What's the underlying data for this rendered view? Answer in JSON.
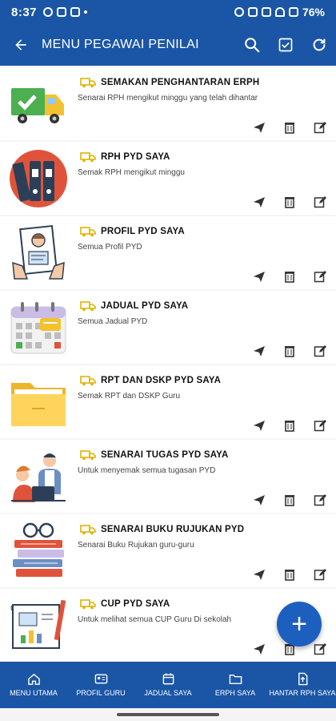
{
  "status_bar": {
    "time": "8:37",
    "battery": "76%"
  },
  "app_bar": {
    "title": "MENU PEGAWAI PENILAI"
  },
  "menu_items": [
    {
      "title": "SEMAKAN PENGHANTARAN ERPH",
      "subtitle": "Senarai RPH mengikut minggu yang telah dihantar"
    },
    {
      "title": "RPH PYD SAYA",
      "subtitle": "Semak RPH mengikut minggu"
    },
    {
      "title": "PROFIL PYD SAYA",
      "subtitle": "Semua Profil PYD"
    },
    {
      "title": "JADUAL PYD SAYA",
      "subtitle": "Semua Jadual PYD"
    },
    {
      "title": "RPT DAN DSKP PYD SAYA",
      "subtitle": "Semak RPT dan DSKP Guru"
    },
    {
      "title": "SENARAI TUGAS PYD SAYA",
      "subtitle": "Untuk menyemak semua tugasan PYD"
    },
    {
      "title": "SENARAI BUKU RUJUKAN PYD",
      "subtitle": "Senarai Buku Rujukan guru-guru"
    },
    {
      "title": "CUP PYD SAYA",
      "subtitle": "Untuk melihat semua CUP Guru Di sekolah"
    }
  ],
  "fab": {
    "label": "+"
  },
  "bottom_nav": [
    {
      "label": "MENU UTAMA"
    },
    {
      "label": "PROFIL GURU"
    },
    {
      "label": "JADUAL SAYA"
    },
    {
      "label": "ERPH SAYA"
    },
    {
      "label": "HANTAR RPH SAYA"
    }
  ],
  "colors": {
    "primary": "#1b56a6",
    "accent_yellow": "#f2c230",
    "fab": "#1d5fbf"
  }
}
